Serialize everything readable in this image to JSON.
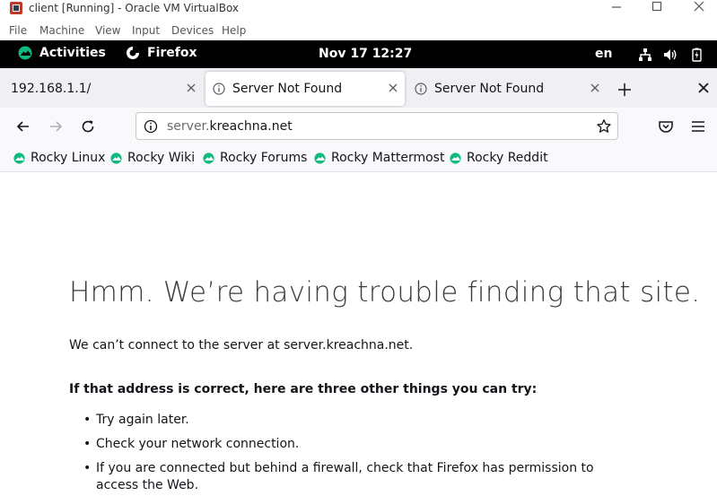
{
  "vbox": {
    "title": "client [Running] - Oracle VM VirtualBox",
    "menu": [
      "File",
      "Machine",
      "View",
      "Input",
      "Devices",
      "Help"
    ]
  },
  "gnome": {
    "activities": "Activities",
    "app": "Firefox",
    "clock": "Nov 17  12:27",
    "lang": "en"
  },
  "tabs": [
    {
      "label": "192.168.1.1/",
      "active": false
    },
    {
      "label": "Server Not Found",
      "active": true
    },
    {
      "label": "Server Not Found",
      "active": false
    }
  ],
  "urlbar": {
    "host_prefix": "server.",
    "host_domain": "kreachna.net"
  },
  "bookmarks": [
    "Rocky Linux",
    "Rocky Wiki",
    "Rocky Forums",
    "Rocky Mattermost",
    "Rocky Reddit"
  ],
  "error": {
    "title": "Hmm. We’re having trouble finding that site.",
    "description": "We can’t connect to the server at server.kreachna.net.",
    "subtitle": "If that address is correct, here are three other things you can try:",
    "items": [
      "Try again later.",
      "Check your network connection.",
      "If you are connected but behind a firewall, check that Firefox has permission to access the Web."
    ]
  },
  "colors": {
    "rocky_green": "#10b981",
    "gnome_bar": "#000000",
    "tabstrip": "#f0f0f4"
  }
}
